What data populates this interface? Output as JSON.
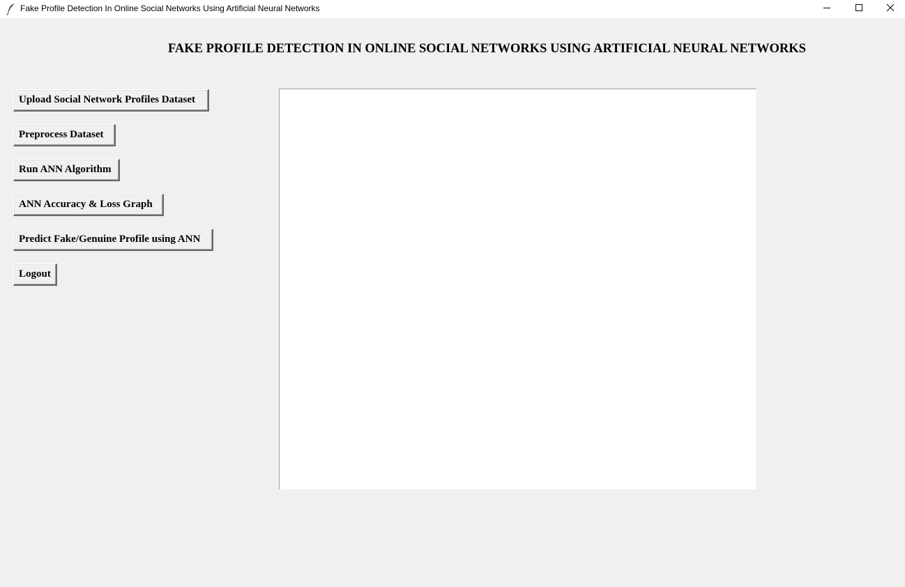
{
  "window": {
    "title": "Fake Profile Detection In Online Social Networks Using Artificial Neural Networks",
    "app_icon": "feather-icon",
    "controls": [
      "minimize-icon",
      "maximize-icon",
      "close-icon"
    ]
  },
  "header": {
    "title": "FAKE PROFILE DETECTION IN ONLINE SOCIAL NETWORKS USING ARTIFICIAL NEURAL NETWORKS"
  },
  "buttons": {
    "upload": "Upload Social Network Profiles Dataset",
    "preprocess": "Preprocess Dataset",
    "run_ann": "Run ANN Algorithm",
    "graph": "ANN Accuracy & Loss Graph",
    "predict": "Predict Fake/Genuine Profile using ANN",
    "logout": "Logout"
  },
  "output": {
    "text": ""
  },
  "colors": {
    "background": "#f0f0f0",
    "titlebar": "#ffffff",
    "text_area": "#ffffff"
  }
}
